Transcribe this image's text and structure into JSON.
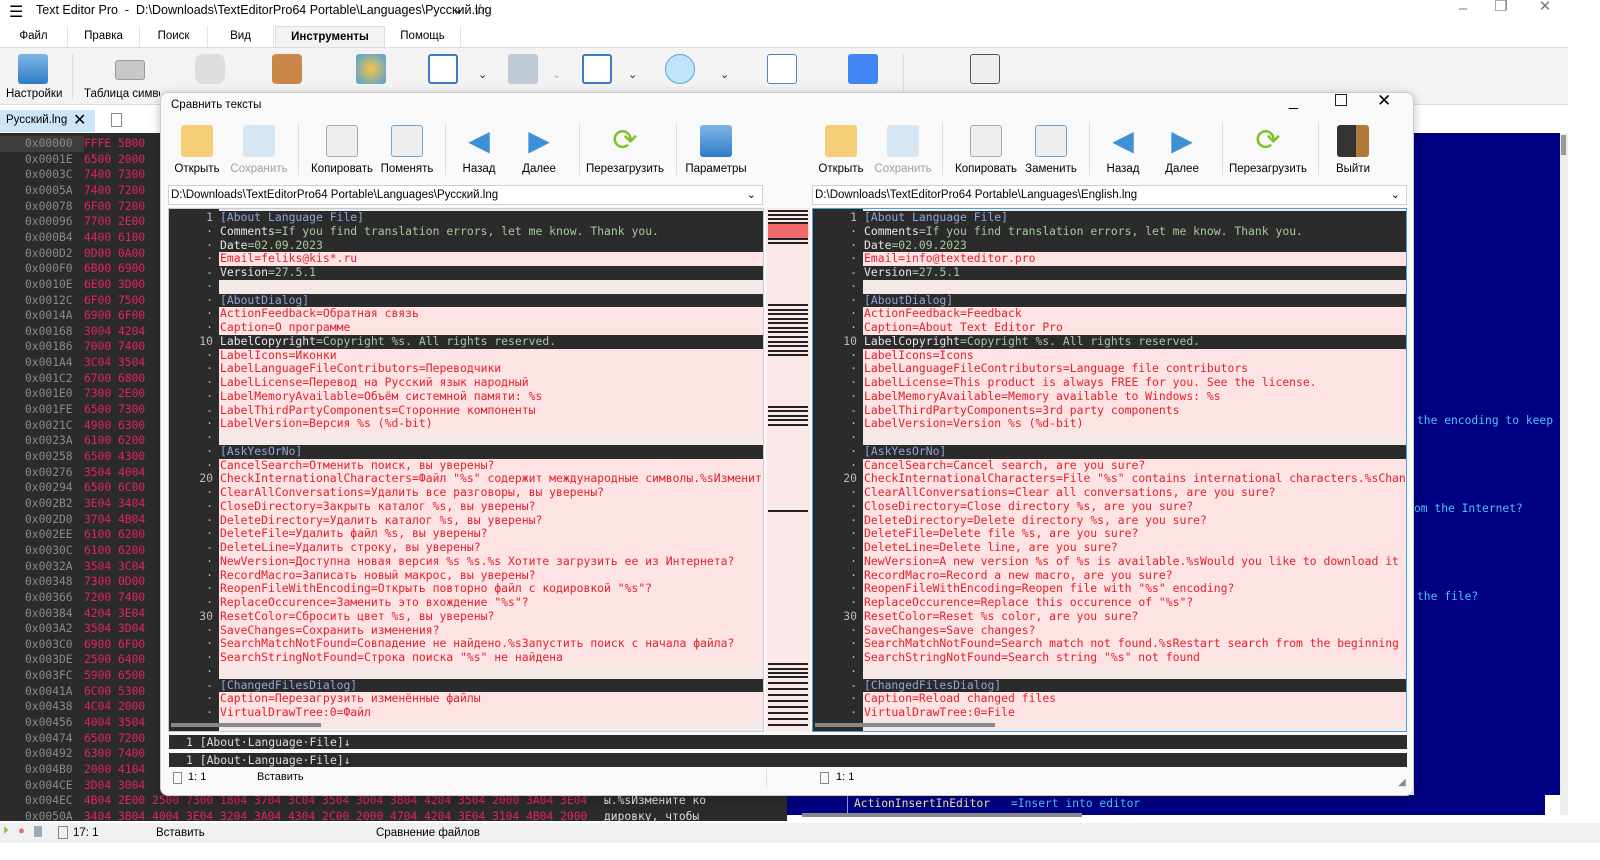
{
  "app": {
    "title": "Text Editor Pro  -  D:\\Downloads\\TextEditorPro64 Portable\\Languages\\Русский.lng",
    "menu_tabs": [
      "Файл",
      "Правка",
      "Поиск",
      "Вид",
      "Инструменты",
      "Помощь"
    ],
    "active_tab": "Инструменты",
    "ribbon": {
      "settings_label": "Настройки",
      "charmap_label": "Таблица символ"
    },
    "doc_tab": "Русский.lng"
  },
  "hex": {
    "rows": [
      [
        "0x00000",
        "FFFE 5B00"
      ],
      [
        "0x0001E",
        "6500 2000"
      ],
      [
        "0x0003C",
        "7400 7300"
      ],
      [
        "0x0005A",
        "7400 7200"
      ],
      [
        "0x00078",
        "6F00 7200"
      ],
      [
        "0x00096",
        "7700 2E00"
      ],
      [
        "0x000B4",
        "4400 6100"
      ],
      [
        "0x000D2",
        "0D00 0A00"
      ],
      [
        "0x000F0",
        "6B00 6900"
      ],
      [
        "0x0010E",
        "6E00 3D00"
      ],
      [
        "0x0012C",
        "6F00 7500"
      ],
      [
        "0x0014A",
        "6900 6F00"
      ],
      [
        "0x00168",
        "3004 4204"
      ],
      [
        "0x00186",
        "7000 7400"
      ],
      [
        "0x001A4",
        "3C04 3504"
      ],
      [
        "0x001C2",
        "6700 6800"
      ],
      [
        "0x001E0",
        "7300 2E00"
      ],
      [
        "0x001FE",
        "6500 7300"
      ],
      [
        "0x0021C",
        "4900 6300"
      ],
      [
        "0x0023A",
        "6100 6200"
      ],
      [
        "0x00258",
        "6500 4300"
      ],
      [
        "0x00276",
        "3504 4004"
      ],
      [
        "0x00294",
        "6500 6C00"
      ],
      [
        "0x002B2",
        "3E04 3404"
      ],
      [
        "0x002D0",
        "3704 4B04"
      ],
      [
        "0x002EE",
        "6100 6200"
      ],
      [
        "0x0030C",
        "6100 6200"
      ],
      [
        "0x0032A",
        "3504 3C04"
      ],
      [
        "0x00348",
        "7300 0D00"
      ],
      [
        "0x00366",
        "7200 7400"
      ],
      [
        "0x00384",
        "4204 3E04"
      ],
      [
        "0x003A2",
        "3504 3D04"
      ],
      [
        "0x003C0",
        "6900 6F00"
      ],
      [
        "0x003DE",
        "2500 6400"
      ],
      [
        "0x003FC",
        "5900 6500"
      ],
      [
        "0x0041A",
        "6C00 5300"
      ],
      [
        "0x00438",
        "4C04 2000"
      ],
      [
        "0x00456",
        "4004 3504"
      ],
      [
        "0x00474",
        "6500 7200"
      ],
      [
        "0x00492",
        "6300 7400"
      ],
      [
        "0x004B0",
        "2000 4104"
      ],
      [
        "0x004CE",
        "3D04 3004"
      ],
      [
        "0x004EC",
        "4B04 2E00 2500 7300 1804 3704 3C04 3504 3D04 3804 4204 3504 2000 3A04 3E04",
        "ы.%sИзмените ко"
      ],
      [
        "0x0050A",
        "3404 3804 4004 3E04 3204 3A04 4304 2C00 2000 4704 4204 3E04 3104 4B04 2000",
        "дировку, чтобы"
      ]
    ]
  },
  "background_editor": {
    "fragments": [
      "the encoding to keep",
      "om the Internet?",
      "the file?"
    ],
    "bottom_line_key": "ActionInsertInEditor",
    "bottom_line_value": "=Insert into editor"
  },
  "statusbar": {
    "position": "17: 1",
    "mode": "Вставить",
    "info": "Сравнение файлов"
  },
  "dialog": {
    "title": "Сравнить тексты",
    "left_toolbar": [
      "Открыть",
      "Сохранить",
      "Копировать",
      "Поменять",
      "Назад",
      "Далее",
      "Перезагрузить",
      "Параметры"
    ],
    "right_toolbar": [
      "Открыть",
      "Сохранить",
      "Копировать",
      "Заменить",
      "Назад",
      "Далее",
      "Перезагрузить",
      "Выйти"
    ],
    "left_path": "D:\\Downloads\\TextEditorPro64 Portable\\Languages\\Русский.lng",
    "right_path": "D:\\Downloads\\TextEditorPro64 Portable\\Languages\\English.lng",
    "left_lines": [
      [
        "[About Language File]",
        0
      ],
      [
        "Comments=If you find translation errors, let me know. Thank you.",
        0
      ],
      [
        "Date=02.09.2023",
        0
      ],
      [
        "Email=feliks@kis*.ru",
        1
      ],
      [
        "Version=27.5.1",
        0
      ],
      [
        "",
        0
      ],
      [
        "[AboutDialog]",
        0
      ],
      [
        "ActionFeedback=Обратная связь",
        1
      ],
      [
        "Caption=О программе",
        1
      ],
      [
        "LabelCopyright=Copyright %s. All rights reserved.",
        0
      ],
      [
        "LabelIcons=Иконки",
        1
      ],
      [
        "LabelLanguageFileContributors=Переводчики",
        1
      ],
      [
        "LabelLicense=Перевод на Русский язык народный",
        1
      ],
      [
        "LabelMemoryAvailable=Объём системной памяти: %s",
        1
      ],
      [
        "LabelThirdPartyComponents=Сторонние компоненты",
        1
      ],
      [
        "LabelVersion=Версия %s (%d-bit)",
        1
      ],
      [
        "",
        0
      ],
      [
        "[AskYesOrNo]",
        0
      ],
      [
        "CancelSearch=Отменить поиск, вы уверены?",
        1
      ],
      [
        "CheckInternationalCharacters=Файл \"%s\" содержит международные символы.%sИзменит",
        1
      ],
      [
        "ClearAllConversations=Удалить все разговоры, вы уверены?",
        1
      ],
      [
        "CloseDirectory=Закрыть каталог %s, вы уверены?",
        1
      ],
      [
        "DeleteDirectory=Удалить каталог %s, вы уверены?",
        1
      ],
      [
        "DeleteFile=Удалить файл %s, вы уверены?",
        1
      ],
      [
        "DeleteLine=Удалить строку, вы уверены?",
        1
      ],
      [
        "NewVersion=Доступна новая версия %s %s.%s Хотите загрузить ее из Интернета?",
        1
      ],
      [
        "RecordMacro=Записать новый макрос, вы уверены?",
        1
      ],
      [
        "ReopenFileWithEncoding=Открыть повторно файл с кодировкой \"%s\"?",
        1
      ],
      [
        "ReplaceOccurence=Заменить это вхождение \"%s\"?",
        1
      ],
      [
        "ResetColor=Сбросить цвет %s, вы уверены?",
        1
      ],
      [
        "SaveChanges=Сохранить изменения?",
        1
      ],
      [
        "SearchMatchNotFound=Совпадение не найдено.%sЗапустить поиск с начала файла?",
        1
      ],
      [
        "SearchStringNotFound=Строка поиска \"%s\" не найдена",
        1
      ],
      [
        "",
        0
      ],
      [
        "[ChangedFilesDialog]",
        0
      ],
      [
        "Caption=Перезагрузить изменённые файлы",
        1
      ],
      [
        "VirtualDrawTree:0=Файл",
        1
      ]
    ],
    "right_lines": [
      [
        "[About Language File]",
        0
      ],
      [
        "Comments=If you find translation errors, let me know. Thank you.",
        0
      ],
      [
        "Date=02.09.2023",
        0
      ],
      [
        "Email=info@texteditor.pro",
        1
      ],
      [
        "Version=27.5.1",
        0
      ],
      [
        "",
        0
      ],
      [
        "[AboutDialog]",
        0
      ],
      [
        "ActionFeedback=Feedback",
        1
      ],
      [
        "Caption=About Text Editor Pro",
        1
      ],
      [
        "LabelCopyright=Copyright %s. All rights reserved.",
        0
      ],
      [
        "LabelIcons=Icons",
        1
      ],
      [
        "LabelLanguageFileContributors=Language file contributors",
        1
      ],
      [
        "LabelLicense=This product is always FREE for you. See the license.",
        1
      ],
      [
        "LabelMemoryAvailable=Memory available to Windows: %s",
        1
      ],
      [
        "LabelThirdPartyComponents=3rd party components",
        1
      ],
      [
        "LabelVersion=Version %s (%d-bit)",
        1
      ],
      [
        "",
        0
      ],
      [
        "[AskYesOrNo]",
        0
      ],
      [
        "CancelSearch=Cancel search, are you sure?",
        1
      ],
      [
        "CheckInternationalCharacters=File \"%s\" contains international characters.%sChan",
        1
      ],
      [
        "ClearAllConversations=Clear all conversations, are you sure?",
        1
      ],
      [
        "CloseDirectory=Close directory %s, are you sure?",
        1
      ],
      [
        "DeleteDirectory=Delete directory %s, are you sure?",
        1
      ],
      [
        "DeleteFile=Delete file %s, are you sure?",
        1
      ],
      [
        "DeleteLine=Delete line, are you sure?",
        1
      ],
      [
        "NewVersion=A new version %s of %s is available.%sWould you like to download it",
        1
      ],
      [
        "RecordMacro=Record a new macro, are you sure?",
        1
      ],
      [
        "ReopenFileWithEncoding=Reopen file with \"%s\" encoding?",
        1
      ],
      [
        "ReplaceOccurence=Replace this occurence of \"%s\"?",
        1
      ],
      [
        "ResetColor=Reset %s color, are you sure?",
        1
      ],
      [
        "SaveChanges=Save changes?",
        1
      ],
      [
        "SearchMatchNotFound=Search match not found.%sRestart search from the beginning",
        1
      ],
      [
        "SearchStringNotFound=Search string \"%s\" not found",
        1
      ],
      [
        "",
        0
      ],
      [
        "[ChangedFilesDialog]",
        0
      ],
      [
        "Caption=Reload changed files",
        1
      ],
      [
        "VirtualDrawTree:0=File",
        1
      ]
    ],
    "bottom_line_1": "1 [About·Language·File]↓",
    "bottom_line_2": "1 [About·Language·File]↓",
    "left_status": {
      "position": "1: 1",
      "mode": "Вставить"
    },
    "right_status": {
      "position": "1: 1"
    }
  }
}
